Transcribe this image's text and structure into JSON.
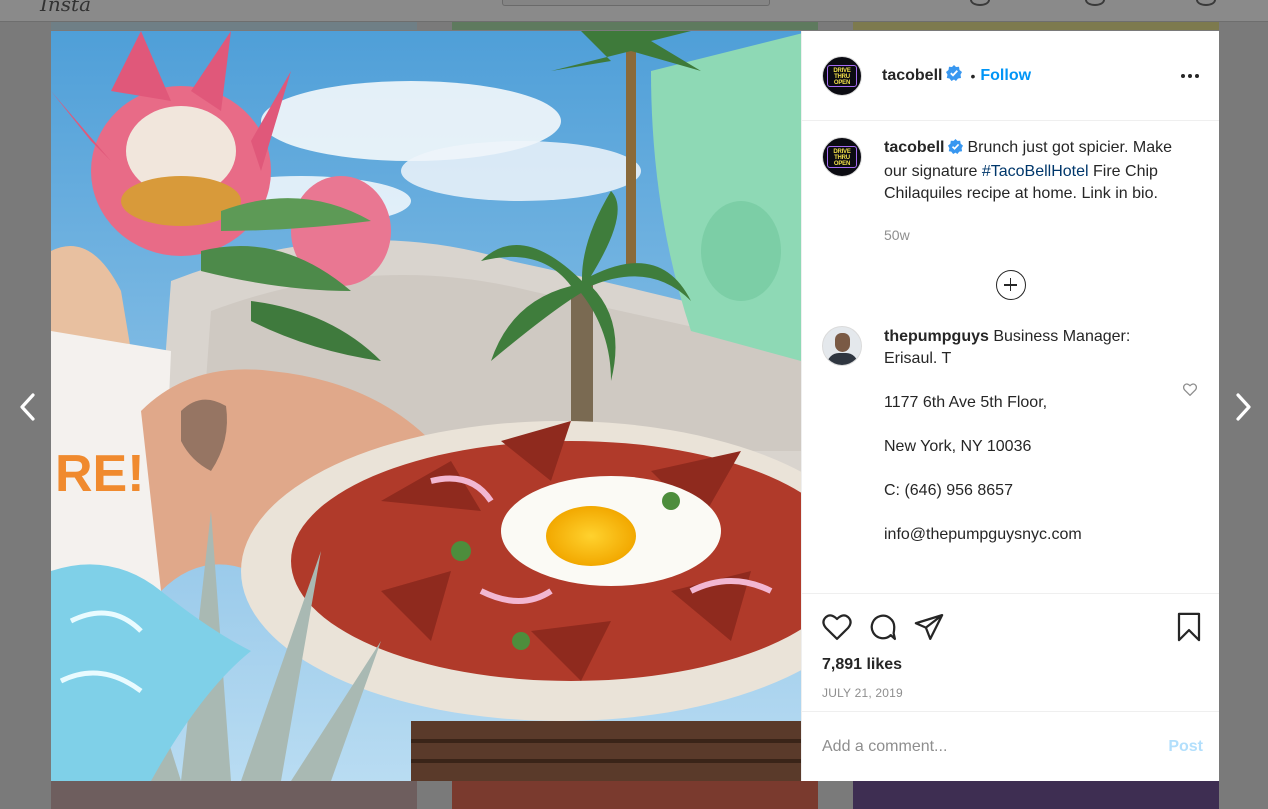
{
  "post": {
    "username": "tacobell",
    "follow_label": "Follow",
    "avatar_text": "DRIVE THRU OPEN",
    "caption": {
      "username": "tacobell",
      "text_before": "Brunch just got spicier. Make our signature ",
      "hashtag": "#TacoBellHotel",
      "text_after": " Fire Chip Chilaquiles recipe at home. Link in bio.",
      "time": "50w"
    },
    "comment": {
      "username": "thepumpguys",
      "line1": "Business Manager: Erisaul. T",
      "line2": "1177 6th Ave 5th Floor,",
      "line3": "New York, NY 10036",
      "line4": "C: (646) 956 8657",
      "line5": "info@thepumpguysnyc.com"
    },
    "likes": "7,891 likes",
    "date": "JULY 21, 2019",
    "comment_placeholder": "Add a comment...",
    "post_label": "Post"
  },
  "icons": {
    "verified": "verified-badge-icon",
    "more": "more-options-icon",
    "like": "heart-icon",
    "comment": "comment-icon",
    "share": "paper-plane-icon",
    "save": "bookmark-icon",
    "load_more": "plus-circle-icon",
    "prev": "chevron-left-icon",
    "next": "chevron-right-icon"
  },
  "colors": {
    "link": "#0095f6",
    "hashtag": "#00376b",
    "post_disabled": "#b2dffc",
    "verified": "#3897f0"
  }
}
